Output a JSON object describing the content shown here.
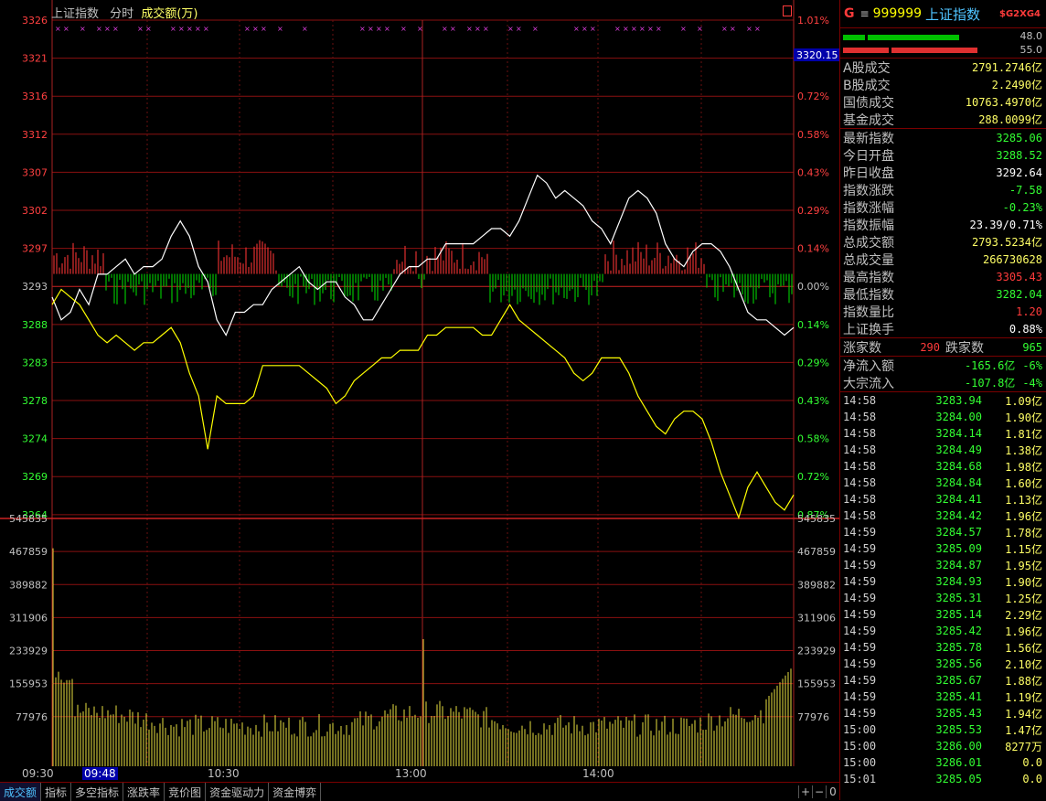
{
  "header": {
    "index_name": "上证指数",
    "mode": "分时",
    "indicator": "成交额(万)"
  },
  "price_axis_left": [
    "3326",
    "3321",
    "3316",
    "3312",
    "3307",
    "3302",
    "3297",
    "3293",
    "3288",
    "3283",
    "3278",
    "3274",
    "3269",
    "3264"
  ],
  "pct_axis_right": [
    "1.01%",
    "",
    "0.72%",
    "0.58%",
    "0.43%",
    "0.29%",
    "0.14%",
    "0.00%",
    "0.14%",
    "0.29%",
    "0.43%",
    "0.58%",
    "0.72%",
    "0.87%"
  ],
  "current_price_box": "3320.15",
  "volume_axis": [
    "545835",
    "467859",
    "389882",
    "311906",
    "233929",
    "155953",
    "77976"
  ],
  "time_labels": [
    "09:30",
    "09:48",
    "10:30",
    "13:00",
    "14:00"
  ],
  "chart_data": {
    "type": "line",
    "base_price": 3292.64,
    "price_range": [
      3259.9,
      3325.4
    ],
    "volume_range": [
      0,
      545835
    ],
    "x_domain_minutes": 240,
    "series": [
      {
        "color": "#ffffff",
        "points": [
          [
            0,
            3289
          ],
          [
            3,
            3286
          ],
          [
            6,
            3287
          ],
          [
            9,
            3290
          ],
          [
            12,
            3288
          ],
          [
            15,
            3292
          ],
          [
            18,
            3292
          ],
          [
            21,
            3293
          ],
          [
            24,
            3294
          ],
          [
            27,
            3292
          ],
          [
            30,
            3293
          ],
          [
            33,
            3293
          ],
          [
            36,
            3294
          ],
          [
            39,
            3297
          ],
          [
            42,
            3299
          ],
          [
            45,
            3297
          ],
          [
            48,
            3293
          ],
          [
            51,
            3291
          ],
          [
            54,
            3286
          ],
          [
            57,
            3284
          ],
          [
            60,
            3287
          ],
          [
            63,
            3287
          ],
          [
            66,
            3288
          ],
          [
            69,
            3288
          ],
          [
            72,
            3290
          ],
          [
            75,
            3291
          ],
          [
            78,
            3292
          ],
          [
            81,
            3293
          ],
          [
            84,
            3291
          ],
          [
            87,
            3290
          ],
          [
            90,
            3291
          ],
          [
            93,
            3291
          ],
          [
            96,
            3289
          ],
          [
            99,
            3288
          ],
          [
            102,
            3286
          ],
          [
            105,
            3286
          ],
          [
            108,
            3288
          ],
          [
            111,
            3290
          ],
          [
            114,
            3292
          ],
          [
            117,
            3293
          ],
          [
            120,
            3293
          ],
          [
            123,
            3294
          ],
          [
            126,
            3294
          ],
          [
            129,
            3296
          ],
          [
            132,
            3296
          ],
          [
            135,
            3296
          ],
          [
            138,
            3296
          ],
          [
            141,
            3297
          ],
          [
            144,
            3298
          ],
          [
            147,
            3298
          ],
          [
            150,
            3297
          ],
          [
            153,
            3299
          ],
          [
            156,
            3302
          ],
          [
            159,
            3305
          ],
          [
            162,
            3304
          ],
          [
            165,
            3302
          ],
          [
            168,
            3303
          ],
          [
            171,
            3302
          ],
          [
            174,
            3301
          ],
          [
            177,
            3299
          ],
          [
            180,
            3298
          ],
          [
            183,
            3296
          ],
          [
            186,
            3299
          ],
          [
            189,
            3302
          ],
          [
            192,
            3303
          ],
          [
            195,
            3302
          ],
          [
            198,
            3300
          ],
          [
            201,
            3296
          ],
          [
            204,
            3294
          ],
          [
            207,
            3293
          ],
          [
            210,
            3295
          ],
          [
            213,
            3296
          ],
          [
            216,
            3296
          ],
          [
            219,
            3295
          ],
          [
            222,
            3293
          ],
          [
            225,
            3290
          ],
          [
            228,
            3287
          ],
          [
            231,
            3286
          ],
          [
            234,
            3286
          ],
          [
            237,
            3285
          ],
          [
            240,
            3284
          ],
          [
            243,
            3285
          ]
        ]
      },
      {
        "color": "#ffff00",
        "points": [
          [
            0,
            3288
          ],
          [
            3,
            3290
          ],
          [
            6,
            3289
          ],
          [
            9,
            3288
          ],
          [
            12,
            3286
          ],
          [
            15,
            3284
          ],
          [
            18,
            3283
          ],
          [
            21,
            3284
          ],
          [
            24,
            3283
          ],
          [
            27,
            3282
          ],
          [
            30,
            3283
          ],
          [
            33,
            3283
          ],
          [
            36,
            3284
          ],
          [
            39,
            3285
          ],
          [
            42,
            3283
          ],
          [
            45,
            3279
          ],
          [
            48,
            3276
          ],
          [
            51,
            3269
          ],
          [
            54,
            3276
          ],
          [
            57,
            3275
          ],
          [
            60,
            3275
          ],
          [
            63,
            3275
          ],
          [
            66,
            3276
          ],
          [
            69,
            3280
          ],
          [
            72,
            3280
          ],
          [
            75,
            3280
          ],
          [
            78,
            3280
          ],
          [
            81,
            3280
          ],
          [
            84,
            3279
          ],
          [
            87,
            3278
          ],
          [
            90,
            3277
          ],
          [
            93,
            3275
          ],
          [
            96,
            3276
          ],
          [
            99,
            3278
          ],
          [
            102,
            3279
          ],
          [
            105,
            3280
          ],
          [
            108,
            3281
          ],
          [
            111,
            3281
          ],
          [
            114,
            3282
          ],
          [
            117,
            3282
          ],
          [
            120,
            3282
          ],
          [
            123,
            3284
          ],
          [
            126,
            3284
          ],
          [
            129,
            3285
          ],
          [
            132,
            3285
          ],
          [
            135,
            3285
          ],
          [
            138,
            3285
          ],
          [
            141,
            3284
          ],
          [
            144,
            3284
          ],
          [
            147,
            3286
          ],
          [
            150,
            3288
          ],
          [
            153,
            3286
          ],
          [
            156,
            3285
          ],
          [
            159,
            3284
          ],
          [
            162,
            3283
          ],
          [
            165,
            3282
          ],
          [
            168,
            3281
          ],
          [
            171,
            3279
          ],
          [
            174,
            3278
          ],
          [
            177,
            3279
          ],
          [
            180,
            3281
          ],
          [
            183,
            3281
          ],
          [
            186,
            3281
          ],
          [
            189,
            3279
          ],
          [
            192,
            3276
          ],
          [
            195,
            3274
          ],
          [
            198,
            3272
          ],
          [
            201,
            3271
          ],
          [
            204,
            3273
          ],
          [
            207,
            3274
          ],
          [
            210,
            3274
          ],
          [
            213,
            3273
          ],
          [
            216,
            3270
          ],
          [
            219,
            3266
          ],
          [
            222,
            3263
          ],
          [
            225,
            3260
          ],
          [
            228,
            3264
          ],
          [
            231,
            3266
          ],
          [
            234,
            3264
          ],
          [
            237,
            3262
          ],
          [
            240,
            3261
          ],
          [
            243,
            3263
          ]
        ]
      }
    ]
  },
  "panel": {
    "g": "G",
    "eq": "≡",
    "code": "999999",
    "name": "上证指数",
    "sg": "$G2XG4",
    "bar_top": "48.0",
    "bar_bottom": "55.0",
    "volumes": [
      {
        "k": "A股成交",
        "v": "2791.2746亿"
      },
      {
        "k": "B股成交",
        "v": "2.2490亿"
      },
      {
        "k": "国债成交",
        "v": "10763.4970亿"
      },
      {
        "k": "基金成交",
        "v": "288.0099亿"
      }
    ],
    "stats": [
      {
        "k": "最新指数",
        "v": "3285.06",
        "c": "gr"
      },
      {
        "k": "今日开盘",
        "v": "3288.52",
        "c": "gr"
      },
      {
        "k": "昨日收盘",
        "v": "3292.64",
        "c": "wh"
      },
      {
        "k": "指数涨跌",
        "v": "-7.58",
        "c": "gr"
      },
      {
        "k": "指数涨幅",
        "v": "-0.23%",
        "c": "gr"
      },
      {
        "k": "指数振幅",
        "v": "23.39/0.71%",
        "c": "wh"
      },
      {
        "k": "总成交额",
        "v": "2793.5234亿",
        "c": "y"
      },
      {
        "k": "总成交量",
        "v": "266730628",
        "c": "y"
      },
      {
        "k": "最高指数",
        "v": "3305.43",
        "c": "rd"
      },
      {
        "k": "最低指数",
        "v": "3282.04",
        "c": "gr"
      },
      {
        "k": "指数量比",
        "v": "1.20",
        "c": "rd"
      },
      {
        "k": "上证换手",
        "v": "0.88%",
        "c": "wh"
      }
    ],
    "up_label": "涨家数",
    "up_value": "290",
    "down_label": "跌家数",
    "down_value": "965",
    "flows": [
      {
        "k": "净流入额",
        "v": "-165.6亿",
        "p": "-6%"
      },
      {
        "k": "大宗流入",
        "v": "-107.8亿",
        "p": "-4%"
      }
    ],
    "ticks": [
      {
        "t": "14:58",
        "p": "3283.94",
        "v": "1.09亿"
      },
      {
        "t": "14:58",
        "p": "3284.00",
        "v": "1.90亿"
      },
      {
        "t": "14:58",
        "p": "3284.14",
        "v": "1.81亿"
      },
      {
        "t": "14:58",
        "p": "3284.49",
        "v": "1.38亿"
      },
      {
        "t": "14:58",
        "p": "3284.68",
        "v": "1.98亿"
      },
      {
        "t": "14:58",
        "p": "3284.84",
        "v": "1.60亿"
      },
      {
        "t": "14:58",
        "p": "3284.41",
        "v": "1.13亿"
      },
      {
        "t": "14:58",
        "p": "3284.42",
        "v": "1.96亿"
      },
      {
        "t": "14:59",
        "p": "3284.57",
        "v": "1.78亿"
      },
      {
        "t": "14:59",
        "p": "3285.09",
        "v": "1.15亿"
      },
      {
        "t": "14:59",
        "p": "3284.87",
        "v": "1.95亿"
      },
      {
        "t": "14:59",
        "p": "3284.93",
        "v": "1.90亿"
      },
      {
        "t": "14:59",
        "p": "3285.31",
        "v": "1.25亿"
      },
      {
        "t": "14:59",
        "p": "3285.14",
        "v": "2.29亿"
      },
      {
        "t": "14:59",
        "p": "3285.42",
        "v": "1.96亿"
      },
      {
        "t": "14:59",
        "p": "3285.78",
        "v": "1.56亿"
      },
      {
        "t": "14:59",
        "p": "3285.56",
        "v": "2.10亿"
      },
      {
        "t": "14:59",
        "p": "3285.67",
        "v": "1.88亿"
      },
      {
        "t": "14:59",
        "p": "3285.41",
        "v": "1.19亿"
      },
      {
        "t": "14:59",
        "p": "3285.43",
        "v": "1.94亿"
      },
      {
        "t": "15:00",
        "p": "3285.53",
        "v": "1.47亿"
      },
      {
        "t": "15:00",
        "p": "3286.00",
        "v": "8277万"
      },
      {
        "t": "15:00",
        "p": "3286.01",
        "v": "0.0"
      },
      {
        "t": "15:01",
        "p": "3285.05",
        "v": "0.0"
      }
    ]
  },
  "bottom_tabs": [
    "成交额",
    "指标",
    "多空指标",
    "涨跌率",
    "竞价图",
    "资金驱动力",
    "资金博弈"
  ],
  "bottom_controls": [
    "+",
    "−",
    "0"
  ]
}
